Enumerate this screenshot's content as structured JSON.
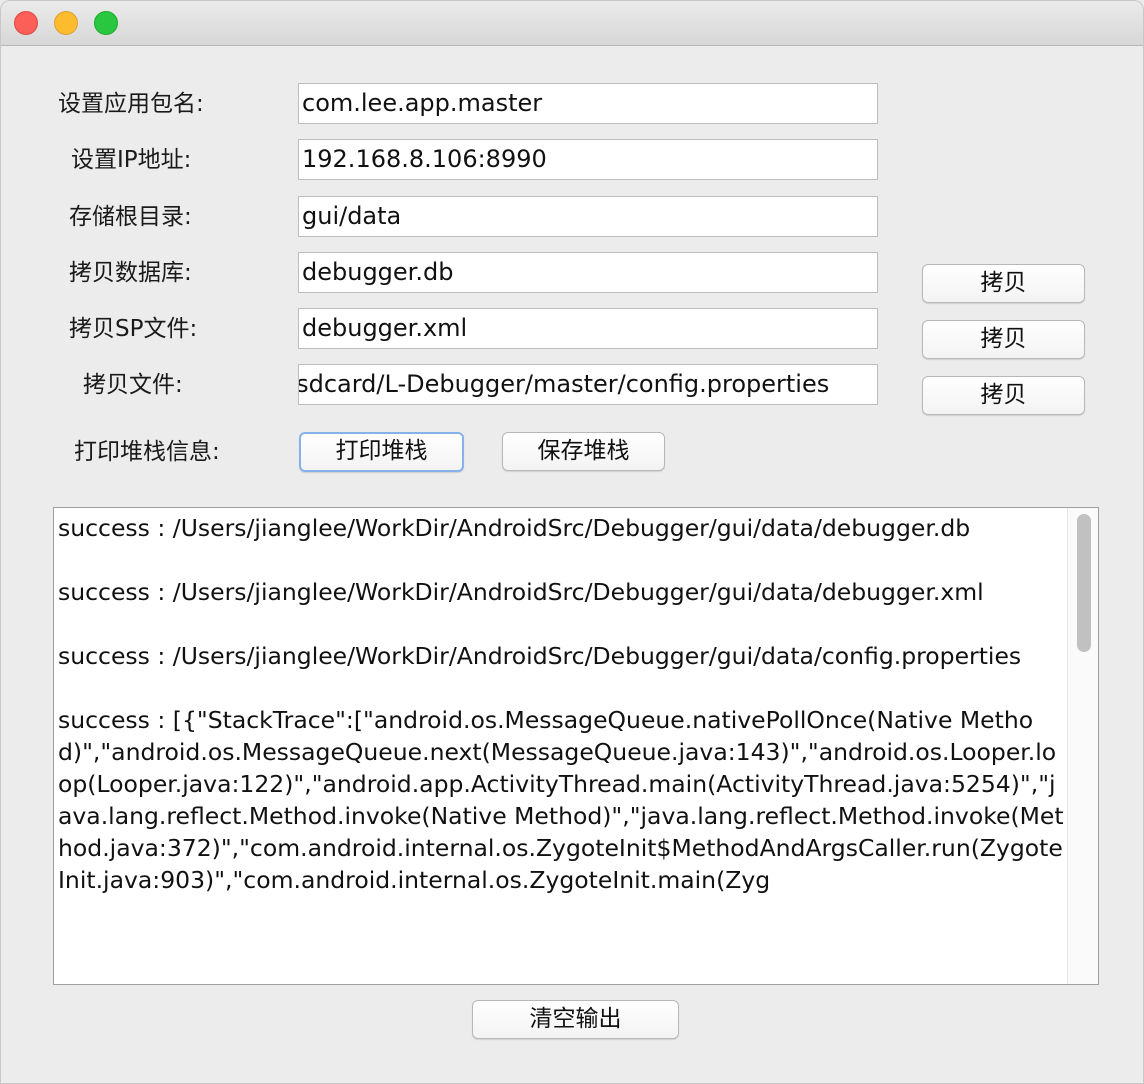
{
  "form": {
    "package_label": "设置应用包名:",
    "package_value": "com.lee.app.master",
    "ip_label": "设置IP地址:",
    "ip_value": "192.168.8.106:8990",
    "root_dir_label": "存储根目录:",
    "root_dir_value": "gui/data",
    "copy_db_label": "拷贝数据库:",
    "copy_db_value": "debugger.db",
    "copy_sp_label": "拷贝SP文件:",
    "copy_sp_value": "debugger.xml",
    "copy_file_label": "拷贝文件:",
    "copy_file_value": "/sdcard/L-Debugger/master/config.properties",
    "copy_button": "拷贝",
    "stack_label": "打印堆栈信息:",
    "print_stack_button": "打印堆栈",
    "save_stack_button": "保存堆栈"
  },
  "output": {
    "text": "success : /Users/jianglee/WorkDir/AndroidSrc/Debugger/gui/data/debugger.db\n\nsuccess : /Users/jianglee/WorkDir/AndroidSrc/Debugger/gui/data/debugger.xml\n\nsuccess : /Users/jianglee/WorkDir/AndroidSrc/Debugger/gui/data/config.properties\n\nsuccess : [{\"StackTrace\":[\"android.os.MessageQueue.nativePollOnce(Native Method)\",\"android.os.MessageQueue.next(MessageQueue.java:143)\",\"android.os.Looper.loop(Looper.java:122)\",\"android.app.ActivityThread.main(ActivityThread.java:5254)\",\"java.lang.reflect.Method.invoke(Native Method)\",\"java.lang.reflect.Method.invoke(Method.java:372)\",\"com.android.internal.os.ZygoteInit$MethodAndArgsCaller.run(ZygoteInit.java:903)\",\"com.android.internal.os.ZygoteInit.main(Zyg",
    "clear_button": "清空输出"
  }
}
